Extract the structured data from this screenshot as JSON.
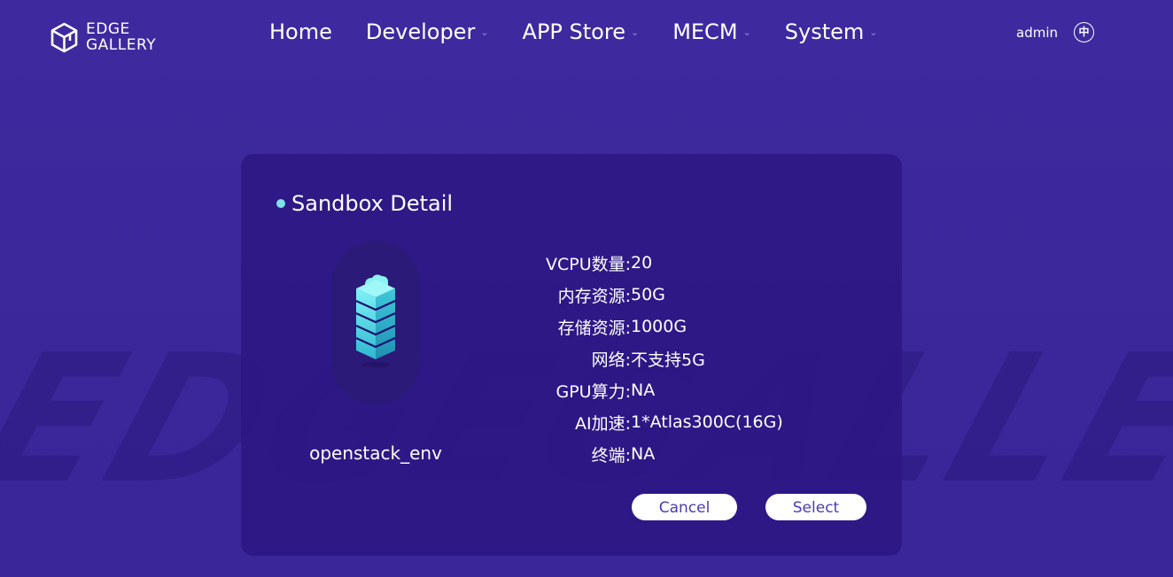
{
  "header": {
    "logo": {
      "line1": "EDGE",
      "line2": "GALLERY"
    },
    "nav": [
      {
        "label": "Home",
        "has_dropdown": false
      },
      {
        "label": "Developer",
        "has_dropdown": true
      },
      {
        "label": "APP Store",
        "has_dropdown": true
      },
      {
        "label": "MECM",
        "has_dropdown": true
      },
      {
        "label": "System",
        "has_dropdown": true
      }
    ],
    "user": "admin",
    "language_icon_label": "中"
  },
  "watermark": "EDGEGALLERY",
  "dialog": {
    "title": "Sandbox Detail",
    "icon": "server-stack-icon",
    "env_name": "openstack_env",
    "details": [
      {
        "label": "VCPU数量:",
        "value": "20"
      },
      {
        "label": "内存资源:",
        "value": "50G"
      },
      {
        "label": "存储资源:",
        "value": "1000G"
      },
      {
        "label": "网络:",
        "value": "不支持5G"
      },
      {
        "label": "GPU算力:",
        "value": "NA"
      },
      {
        "label": "AI加速:",
        "value": "1*Atlas300C(16G)"
      },
      {
        "label": "终端:",
        "value": "NA"
      }
    ],
    "buttons": {
      "cancel": "Cancel",
      "select": "Select"
    }
  },
  "colors": {
    "background": "#3d2a9c",
    "card": "#2d1682",
    "accent_dot": "#7fe3ee",
    "button_text": "#4a3bb3"
  }
}
